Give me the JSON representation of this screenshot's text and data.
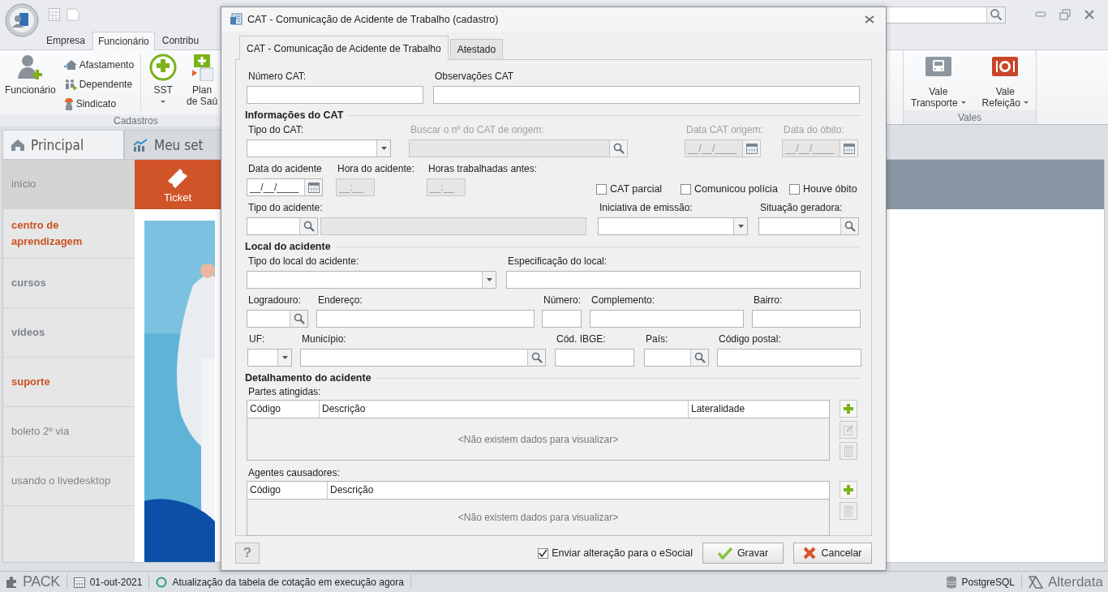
{
  "ribbon": {
    "tabs": [
      {
        "label": "Empresa",
        "selected": false
      },
      {
        "label": "Funcionário",
        "selected": true
      },
      {
        "label": "Contribu",
        "selected": false
      }
    ],
    "cadastros": {
      "label": "Cadastros",
      "employee": "Funcionário",
      "small": [
        "Afastamento",
        "Dependente",
        "Sindicato"
      ],
      "sst": "SST",
      "plan": [
        "Plan",
        "de Saú"
      ]
    },
    "vales": {
      "label": "Vales",
      "buttons": [
        {
          "kind": "bus",
          "lines": [
            "Vale",
            "Transporte"
          ]
        },
        {
          "kind": "meal",
          "lines": [
            "Vale",
            "Refeição"
          ]
        }
      ]
    }
  },
  "content_tabs": [
    {
      "label": "Principal",
      "kind": "home",
      "selected": true
    },
    {
      "label": "Meu set",
      "kind": "chart",
      "selected": false
    }
  ],
  "sidebar": {
    "items": [
      {
        "label": "início",
        "kind": "plain",
        "selected": true
      },
      {
        "label": "centro de aprendizagem",
        "kind": "accent",
        "selected": false
      },
      {
        "label": "cursos",
        "kind": "bold",
        "selected": false
      },
      {
        "label": "vídeos",
        "kind": "bold",
        "selected": false
      },
      {
        "label": "suporte",
        "kind": "accent",
        "selected": false
      },
      {
        "label": "boleto 2º via",
        "kind": "plain",
        "selected": false
      },
      {
        "label": "usando o livedesktop",
        "kind": "plain",
        "selected": false
      }
    ]
  },
  "ticket_tile": {
    "label": "Ticket"
  },
  "dialog": {
    "title": "CAT - Comunicação de Acidente de Trabalho (cadastro)",
    "tabs": [
      {
        "label": "CAT - Comunicação de Acidente de Trabalho",
        "selected": true
      },
      {
        "label": "Atestado",
        "selected": false
      }
    ],
    "form": [
      {
        "kind": "row",
        "fields": [
          {
            "kind": "text",
            "label": "Número CAT:",
            "disabled": false
          },
          {
            "kind": "text",
            "label": "Observações CAT",
            "disabled": false
          }
        ]
      },
      {
        "kind": "section",
        "title": "Informações do CAT"
      },
      {
        "kind": "row",
        "fields": [
          {
            "kind": "combo",
            "label": "Tipo do CAT:",
            "disabled": false
          },
          {
            "kind": "search",
            "label": "Buscar o nº do CAT de origem:",
            "disabled": true
          },
          {
            "kind": "date",
            "label": "Data CAT origem:",
            "placeholder": "__/__/____",
            "disabled": true
          },
          {
            "kind": "date",
            "label": "Data do óbito:",
            "placeholder": "__/__/____",
            "disabled": true
          }
        ]
      },
      {
        "kind": "row",
        "fields": [
          {
            "kind": "date",
            "label": "Data do acidente",
            "placeholder": "__/__/____",
            "disabled": false
          },
          {
            "kind": "time",
            "label": "Hora do acidente:",
            "placeholder": "__:__",
            "disabled": true
          },
          {
            "kind": "time",
            "label": "Horas trabalhadas antes:",
            "placeholder": "__:__",
            "disabled": true
          },
          {
            "kind": "checkbox",
            "label": "CAT parcial",
            "checked": false
          },
          {
            "kind": "checkbox",
            "label": "Comunicou polícia",
            "checked": false
          },
          {
            "kind": "checkbox",
            "label": "Houve óbito",
            "checked": false
          }
        ]
      },
      {
        "kind": "row",
        "fields": [
          {
            "kind": "lookup",
            "label": "Tipo do acidente:",
            "disabled": false,
            "detail_disabled": true
          },
          {
            "kind": "combo",
            "label": "Iniciativa de emissão:",
            "disabled": false
          },
          {
            "kind": "search",
            "label": "Situação geradora:",
            "disabled": false
          }
        ]
      },
      {
        "kind": "section",
        "title": "Local do acidente"
      },
      {
        "kind": "row",
        "fields": [
          {
            "kind": "combo",
            "label": "Tipo do local do acidente:",
            "disabled": false
          },
          {
            "kind": "text",
            "label": "Especificação do local:",
            "disabled": false
          }
        ]
      },
      {
        "kind": "row",
        "fields": [
          {
            "kind": "search",
            "label": "Logradouro:",
            "disabled": false
          },
          {
            "kind": "text",
            "label": "Endereço:",
            "disabled": false
          },
          {
            "kind": "text",
            "label": "Número:",
            "disabled": false
          },
          {
            "kind": "text",
            "label": "Complemento:",
            "disabled": false
          },
          {
            "kind": "text",
            "label": "Bairro:",
            "disabled": false
          }
        ]
      },
      {
        "kind": "row",
        "fields": [
          {
            "kind": "combo",
            "label": "UF:",
            "disabled": false
          },
          {
            "kind": "search",
            "label": "Município:",
            "disabled": false
          },
          {
            "kind": "text",
            "label": "Cód. IBGE:",
            "disabled": false
          },
          {
            "kind": "search",
            "label": "País:",
            "disabled": false
          },
          {
            "kind": "text",
            "label": "Código postal:",
            "disabled": false
          }
        ]
      }
    ],
    "details": {
      "title": "Detalhamento do acidente",
      "grids": [
        {
          "label": "Partes atingidas:",
          "columns": [
            "Código",
            "Descrição",
            "Lateralidade"
          ],
          "empty": "<Não existem dados para visualizar>",
          "actions": [
            {
              "kind": "add",
              "disabled": false
            },
            {
              "kind": "edit",
              "disabled": true
            },
            {
              "kind": "delete",
              "disabled": true
            }
          ]
        },
        {
          "label": "Agentes causadores:",
          "columns": [
            "Código",
            "Descrição"
          ],
          "empty": "<Não existem dados para visualizar>",
          "actions": [
            {
              "kind": "add",
              "disabled": false
            },
            {
              "kind": "delete",
              "disabled": true
            }
          ]
        }
      ]
    },
    "footer": {
      "help": "?",
      "esocial": {
        "label": "Enviar alteração para o eSocial",
        "checked": true
      },
      "buttons": [
        {
          "kind": "save",
          "label": "Gravar"
        },
        {
          "kind": "cancel",
          "label": "Cancelar"
        }
      ]
    }
  },
  "status_bar": {
    "product": "PACK",
    "date": "01-out-2021",
    "message": "Atualização da tabela de cotação em execução agora",
    "database": "PostgreSQL",
    "brand": "Alterdata"
  }
}
